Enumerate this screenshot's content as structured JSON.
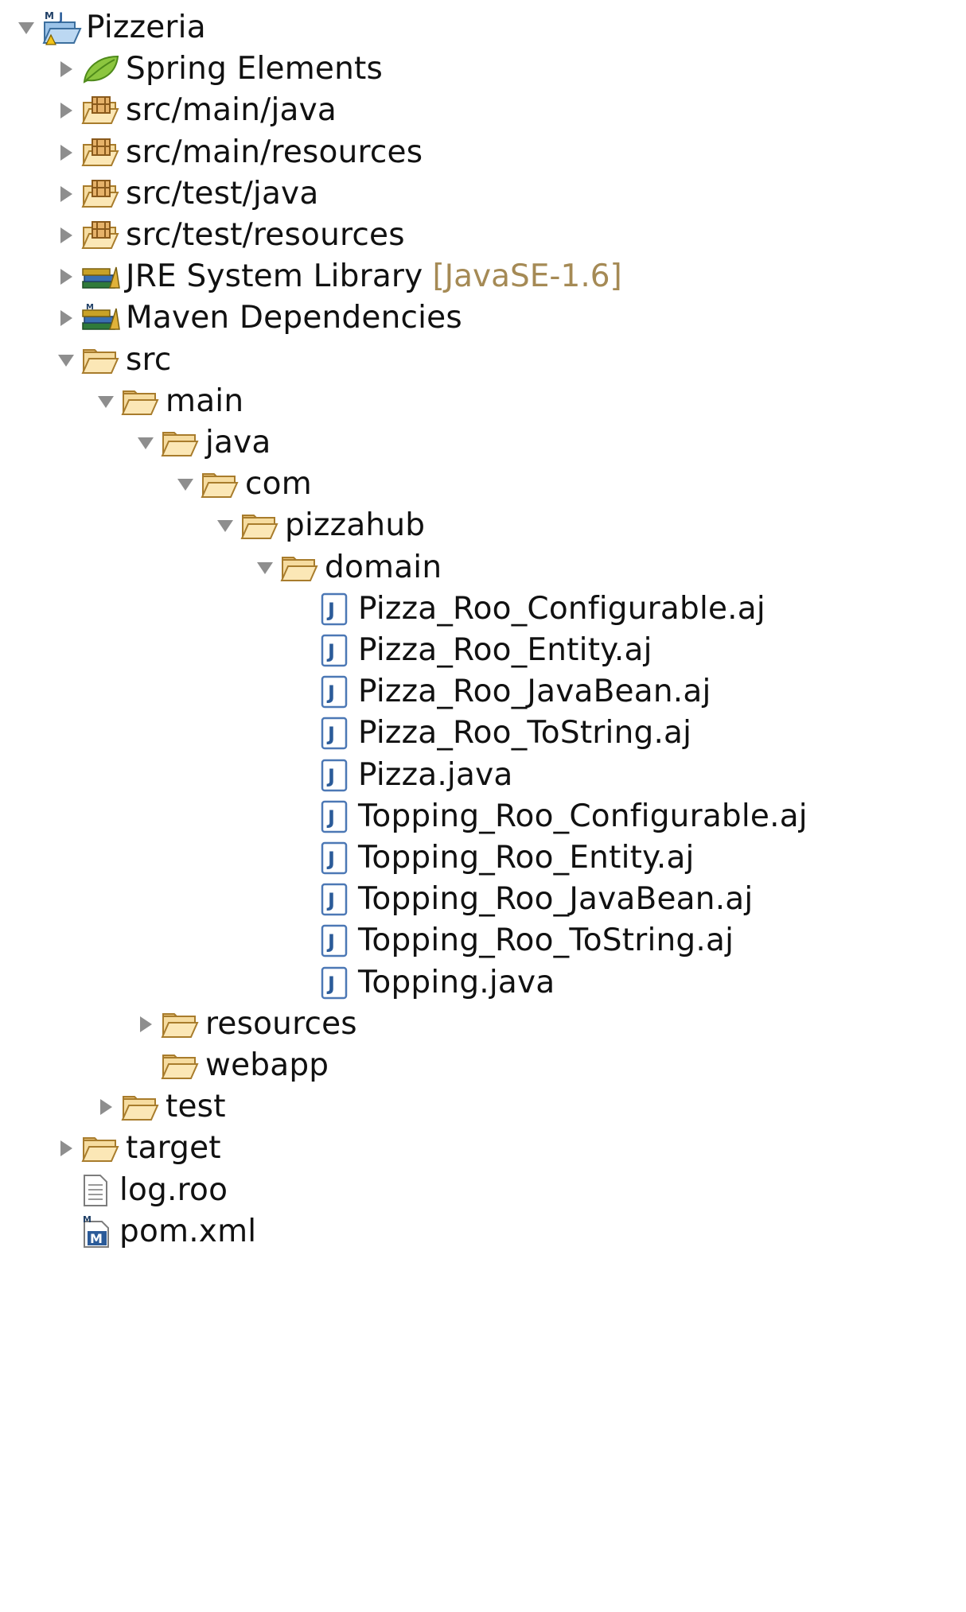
{
  "tree": {
    "project": "Pizzeria",
    "spring_elements": "Spring Elements",
    "src_main_java": "src/main/java",
    "src_main_resources": "src/main/resources",
    "src_test_java": "src/test/java",
    "src_test_resources": "src/test/resources",
    "jre_library": "JRE System Library",
    "jre_version": "[JavaSE-1.6]",
    "maven_deps": "Maven Dependencies",
    "src": "src",
    "main": "main",
    "java": "java",
    "com": "com",
    "pizzahub": "pizzahub",
    "domain": "domain",
    "files": [
      "Pizza_Roo_Configurable.aj",
      "Pizza_Roo_Entity.aj",
      "Pizza_Roo_JavaBean.aj",
      "Pizza_Roo_ToString.aj",
      "Pizza.java",
      "Topping_Roo_Configurable.aj",
      "Topping_Roo_Entity.aj",
      "Topping_Roo_JavaBean.aj",
      "Topping_Roo_ToString.aj",
      "Topping.java"
    ],
    "resources": "resources",
    "webapp": "webapp",
    "test": "test",
    "target": "target",
    "log_roo": "log.roo",
    "pom_xml": "pom.xml"
  },
  "icons": {
    "project": "maven-java-project-icon",
    "spring": "spring-leaf-icon",
    "source_folder": "package-source-folder-icon",
    "library": "library-books-icon",
    "folder": "open-folder-icon",
    "java_file": "java-file-icon",
    "text_file": "text-file-icon",
    "maven_file": "maven-pom-icon"
  }
}
